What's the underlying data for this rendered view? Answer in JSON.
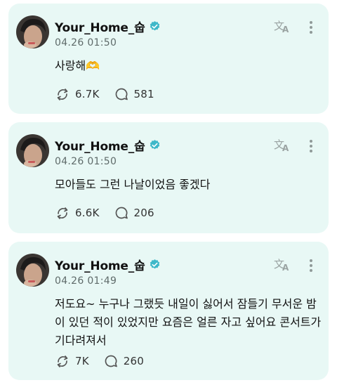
{
  "colors": {
    "card_bg": "#e8f8f5",
    "verified": "#3fb8c9",
    "meta": "#5f6b6a"
  },
  "posts": [
    {
      "username": "Your_Home_숩",
      "timestamp": "04.26 01:50",
      "text": "사랑해🫶",
      "stats": {
        "reposts": "6.7K",
        "comments": "581"
      }
    },
    {
      "username": "Your_Home_숩",
      "timestamp": "04.26 01:50",
      "text": "모아들도 그런 나날이었음 좋겠다",
      "stats": {
        "reposts": "6.6K",
        "comments": "206"
      }
    },
    {
      "username": "Your_Home_숩",
      "timestamp": "04.26 01:49",
      "text": "저도요~ 누구나 그랬듯 내일이 싫어서 잠들기 무서운 밤이 있던 적이 있었지만 요즘은 얼른 자고 싶어요 콘서트가 기다려져서",
      "stats": {
        "reposts": "7K",
        "comments": "260"
      }
    }
  ],
  "icons": {
    "verified": "verified-badge-icon",
    "translate": "translate-icon",
    "more": "more-vertical-icon",
    "repost": "repost-icon",
    "comment": "comment-icon"
  }
}
